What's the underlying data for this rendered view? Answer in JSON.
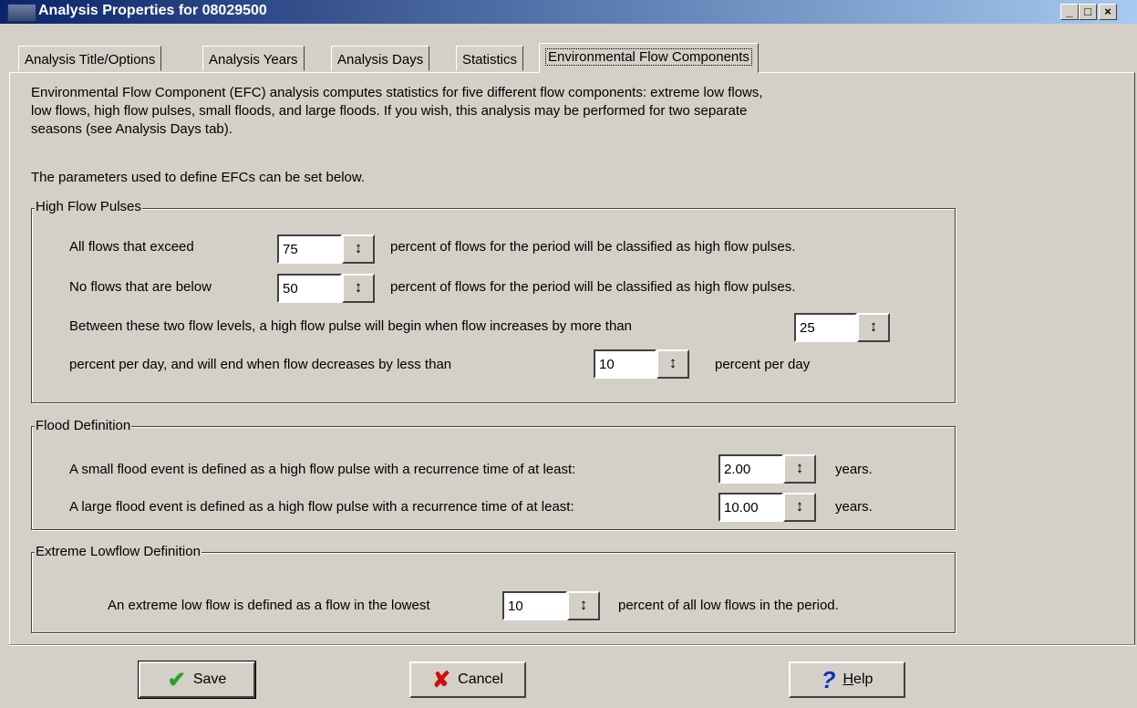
{
  "window": {
    "title": "Analysis Properties for 08029500",
    "min": "_",
    "max": "□",
    "close": "×"
  },
  "tabs": [
    {
      "label": "Analysis Title/Options"
    },
    {
      "label": "Analysis Years"
    },
    {
      "label": "Analysis Days"
    },
    {
      "label": "Statistics"
    },
    {
      "label": "Environmental Flow Components"
    }
  ],
  "description": {
    "line1": "Environmental Flow Component (EFC) analysis computes statistics for five different flow components: extreme low flows,",
    "line2": "low flows, high flow pulses, small floods, and large floods.  If you wish, this analysis may be performed for two separate",
    "line3": "seasons (see Analysis Days tab).",
    "line4": "The parameters used to define EFCs can be set below."
  },
  "high_flow_pulses": {
    "title": "High Flow Pulses",
    "exceed_label": "All flows that exceed",
    "exceed_value": "75",
    "exceed_suffix": "percent of flows for the period will be classified as high flow pulses.",
    "below_label": "No flows that are below",
    "below_value": "50",
    "below_suffix": "percent of flows for the period will be classified as high flow pulses.",
    "between_label": "Between these two flow levels, a high flow pulse will begin when flow increases by more than",
    "increase_value": "25",
    "end_label": "percent per day, and will end when flow decreases by less than",
    "decrease_value": "10",
    "end_suffix": "percent per day"
  },
  "flood_definition": {
    "title": "Flood Definition",
    "small_label": "A small flood event is defined as a high flow pulse with a recurrence time of at least:",
    "small_value": "2.00",
    "small_suffix": "years.",
    "large_label": "A large flood event is defined as a high flow pulse with a recurrence time of at least:",
    "large_value": "10.00",
    "large_suffix": "years."
  },
  "extreme_lowflow": {
    "title": "Extreme Lowflow Definition",
    "label": "An extreme low flow is defined as a flow in the lowest",
    "value": "10",
    "suffix": "percent of all low flows in the period."
  },
  "buttons": {
    "save": "Save",
    "cancel": "Cancel",
    "help_rest": "elp",
    "help_mnemonic": "H"
  },
  "colors": {
    "titlebar_start": "#0a246a",
    "titlebar_end": "#a6caf0",
    "face": "#d4d0c8",
    "save_check": "#2aa02a",
    "cancel_x": "#cc1010",
    "help_q": "#1030c0"
  }
}
